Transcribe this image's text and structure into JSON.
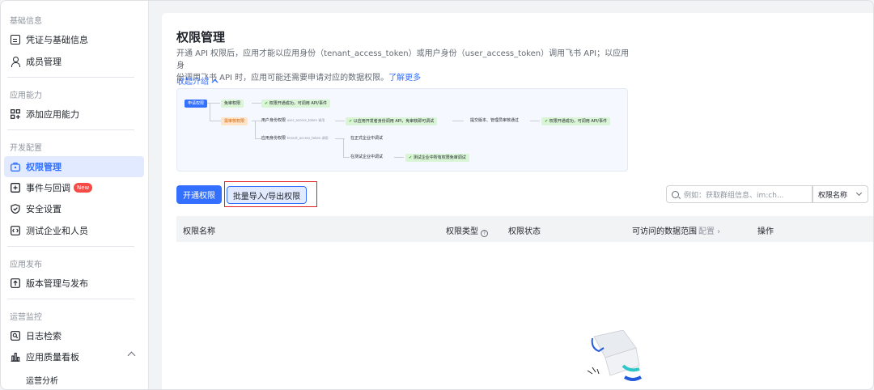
{
  "sidebar": {
    "sections": [
      {
        "title": "基础信息",
        "items": [
          {
            "label": "凭证与基础信息",
            "icon": "credential-card-icon"
          },
          {
            "label": "成员管理",
            "icon": "member-icon"
          }
        ]
      },
      {
        "title": "应用能力",
        "items": [
          {
            "label": "添加应用能力",
            "icon": "add-capability-icon"
          }
        ]
      },
      {
        "title": "开发配置",
        "items": [
          {
            "label": "权限管理",
            "icon": "permission-icon",
            "active": true
          },
          {
            "label": "事件与回调",
            "icon": "event-icon",
            "badge": "New"
          },
          {
            "label": "安全设置",
            "icon": "shield-icon"
          },
          {
            "label": "测试企业和人员",
            "icon": "code-icon"
          }
        ]
      },
      {
        "title": "应用发布",
        "items": [
          {
            "label": "版本管理与发布",
            "icon": "upload-icon"
          }
        ]
      },
      {
        "title": "运营监控",
        "items": [
          {
            "label": "日志检索",
            "icon": "log-search-icon"
          },
          {
            "label": "应用质量看板",
            "icon": "chart-icon"
          }
        ]
      }
    ],
    "sub_item": "运营分析"
  },
  "main": {
    "title": "权限管理",
    "desc_line1": "开通 API 权限后，应用才能以应用身份（tenant_access_token）或用户身份（user_access_token）调用飞书 API；以应用身",
    "desc_line2": "份调用飞书 API 时，应用可能还需要申请对应的数据权限。",
    "learn_more": "了解更多",
    "collapse": "收起介绍",
    "flow": {
      "apply": "申请权限",
      "no_review": "免审权限",
      "success1": "权限开通成功，可调用 API/事件",
      "need_review": "需审核权限",
      "user_perm": "用户身份权限",
      "user_token": "user_access_token 调用",
      "dev_identity": "以应用开发者身份调用 API，免审核即可调试",
      "submit": "提交版本、管理员审核通过",
      "success2": "权限开通成功，可调用 API/事件",
      "app_perm": "应用身份权限",
      "tenant_token": "tenant_access_token 调用",
      "formal": "在正式企业中调试",
      "test": "在测试企业中调试",
      "test_free": "测试企业中所有权限免审调试"
    },
    "btn_open": "开通权限",
    "btn_batch": "批量导入/导出权限",
    "search_placeholder": "例如：获取群组信息、im:ch...",
    "select_value": "权限名称",
    "table": {
      "col_name": "权限名称",
      "col_type": "权限类型",
      "col_status": "权限状态",
      "col_scope": "可访问的数据范围",
      "col_scope_cfg": "配置",
      "col_action": "操作"
    }
  }
}
